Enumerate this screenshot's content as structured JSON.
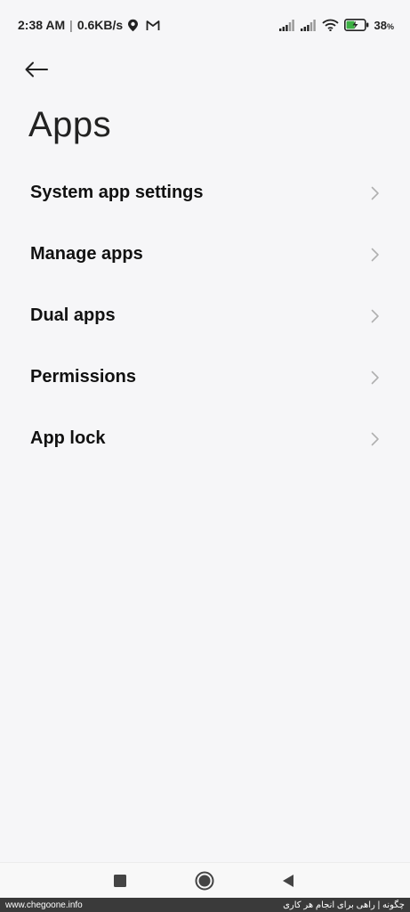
{
  "status_bar": {
    "time": "2:38 AM",
    "separator": "|",
    "net_speed": "0.6KB/s",
    "location_icon": "location-pin-icon",
    "mail_icon": "gmail-icon",
    "signal_icons": [
      "signal-icon",
      "signal-icon"
    ],
    "wifi_icon": "wifi-icon",
    "battery_icon": "battery-charging-icon",
    "battery_percent": "38",
    "battery_percent_sign": "%",
    "accent_color": "#3cb043"
  },
  "header": {
    "back_icon": "back-arrow-icon",
    "title": "Apps"
  },
  "menu": {
    "items": [
      {
        "label": "System app settings",
        "icon": "chevron-right-icon"
      },
      {
        "label": "Manage apps",
        "icon": "chevron-right-icon"
      },
      {
        "label": "Dual apps",
        "icon": "chevron-right-icon"
      },
      {
        "label": "Permissions",
        "icon": "chevron-right-icon"
      },
      {
        "label": "App lock",
        "icon": "chevron-right-icon"
      }
    ]
  },
  "navigation": {
    "recents_icon": "square-recents-icon",
    "home_icon": "circle-home-icon",
    "back_icon": "triangle-back-icon"
  },
  "watermark": {
    "left": "www.chegoone.info",
    "right": "چگونه | راهی برای انجام هر کاری"
  }
}
